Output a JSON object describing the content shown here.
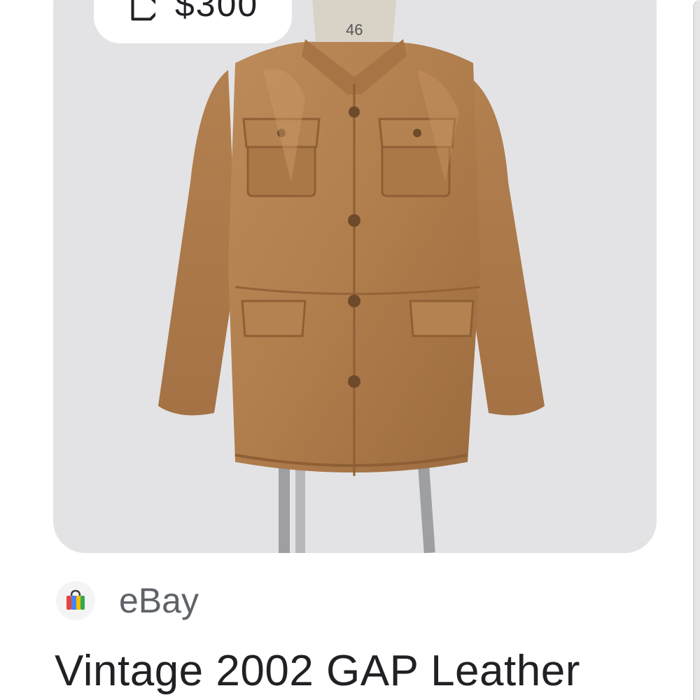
{
  "listing": {
    "price": "$300",
    "price_icon": "tag-icon",
    "image_alt": "Brown leather jacket on a mannequin stand",
    "mannequin_tag": "46",
    "merchant": {
      "name": "eBay",
      "icon": "shopping-bag-icon"
    },
    "title": "Vintage 2002 GAP Leather"
  },
  "colors": {
    "image_background": "#e3e3e5",
    "jacket": "#b07d4c",
    "text_primary": "#202124",
    "text_secondary": "#5f6368",
    "bag_blue": "#4285f4",
    "bag_red": "#ea4335",
    "bag_yellow": "#fbbc04",
    "bag_green": "#34a853"
  }
}
